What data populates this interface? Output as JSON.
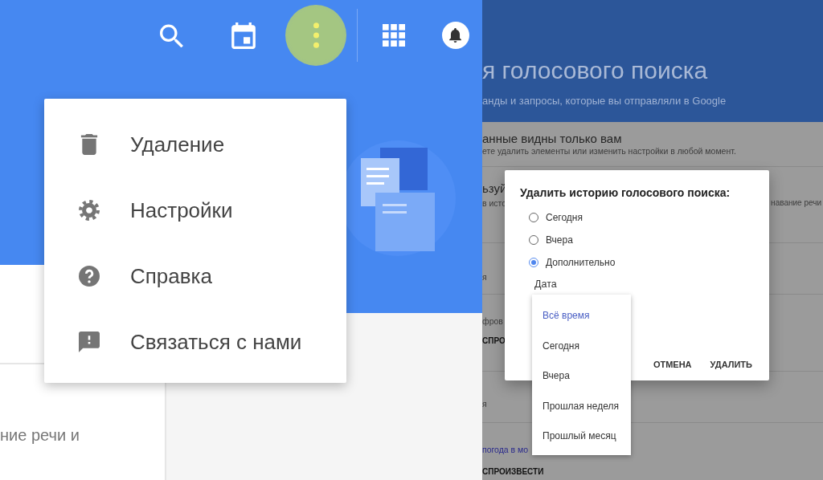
{
  "left_screen": {
    "toolbar": {
      "left": [
        {
          "kind": "search",
          "pressed": false
        },
        {
          "kind": "calendar",
          "pressed": false
        },
        {
          "kind": "more",
          "pressed": true
        }
      ],
      "right": [
        {
          "kind": "apps",
          "pressed": false
        },
        {
          "kind": "bell",
          "pressed": false
        }
      ]
    },
    "menu": [
      {
        "kind": "trash",
        "label": "Удаление"
      },
      {
        "kind": "gear",
        "label": "Настройки"
      },
      {
        "kind": "help",
        "label": "Справка"
      },
      {
        "kind": "feedback",
        "label": "Связаться с нами"
      }
    ],
    "card_text": "ние речи и"
  },
  "right_screen": {
    "page_title": "я голосового поиска",
    "page_subtitle": "анды и запросы, которые вы отправляли в Google",
    "privacy": {
      "heading": "анные видны только вам",
      "text": "ете удалить элементы или изменить настройки в любой момент."
    },
    "rows": [
      {
        "lines": [
          {
            "kind": "heading",
            "text": "ьзуй"
          },
          {
            "kind": "text",
            "text": "в исто"
          }
        ],
        "right_text": "навание речи"
      },
      {
        "lines": [
          {
            "kind": "text",
            "text": "я"
          }
        ]
      },
      {
        "lines": [
          {
            "kind": "text",
            "text": "фров"
          },
          {
            "kind": "action",
            "text": "СПРО"
          }
        ]
      },
      {
        "lines": [
          {
            "kind": "text",
            "text": "я"
          }
        ]
      },
      {
        "lines": [
          {
            "kind": "link",
            "text": "погода в мо"
          },
          {
            "kind": "action",
            "text": "СПРОИЗВЕСТИ"
          }
        ]
      }
    ],
    "dialog": {
      "title": "Удалить историю голосового поиска:",
      "options": [
        {
          "label": "Сегодня",
          "selected": false
        },
        {
          "label": "Вчера",
          "selected": false
        },
        {
          "label": "Дополнительно",
          "selected": true
        }
      ],
      "date_label": "Дата",
      "dropdown": [
        {
          "label": "Всё время",
          "selected": true
        },
        {
          "label": "Сегодня",
          "selected": false
        },
        {
          "label": "Вчера",
          "selected": false
        },
        {
          "label": "Прошлая неделя",
          "selected": false
        },
        {
          "label": "Прошлый месяц",
          "selected": false
        }
      ],
      "buttons": [
        "ОТМЕНА",
        "УДАЛИТЬ"
      ]
    }
  }
}
